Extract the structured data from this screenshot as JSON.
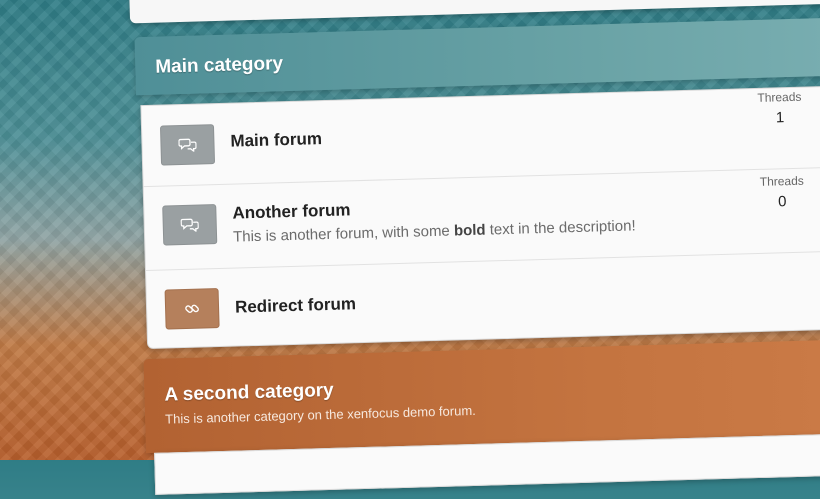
{
  "category1": {
    "title": "Main category",
    "forums": [
      {
        "name": "Main forum",
        "icon": "chat-bubbles-icon",
        "stat_label": "Threads",
        "stat_value": "1"
      },
      {
        "name": "Another forum",
        "icon": "chat-bubbles-icon",
        "stat_label": "Threads",
        "stat_value": "0",
        "desc_before": "This is another forum, with some ",
        "desc_bold": "bold",
        "desc_after": " text in the description!"
      },
      {
        "name": "Redirect forum",
        "icon": "link-icon"
      }
    ]
  },
  "category2": {
    "title": "A second category",
    "description": "This is another category on the xenfocus demo forum."
  },
  "colors": {
    "category1": "#5e9aa0",
    "category2": "#bb6a38",
    "icon_gray": "#9aa0a2",
    "icon_brown": "#b5805c"
  }
}
